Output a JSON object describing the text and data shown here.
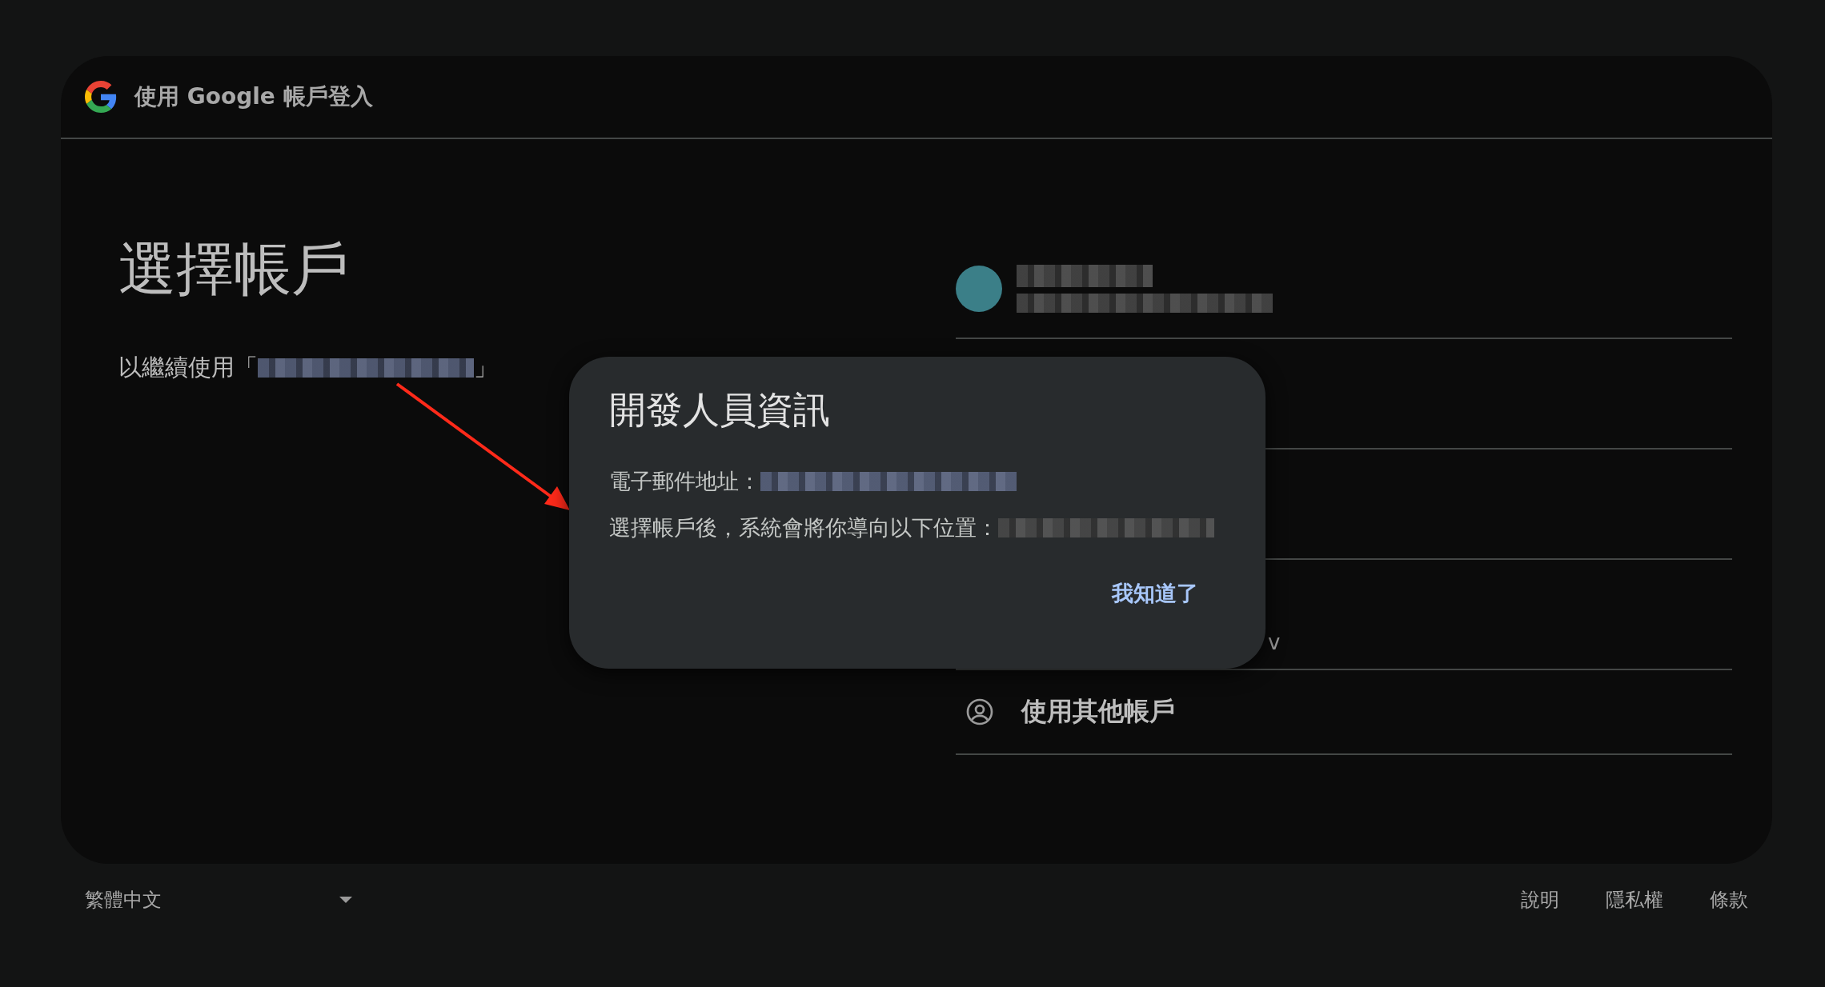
{
  "header": {
    "title": "使用 Google 帳戶登入"
  },
  "heading": "選擇帳戶",
  "subtitle_prefix": "以繼續使用「",
  "subtitle_suffix": "」",
  "account_rows": [
    {
      "kind": "account"
    },
    {
      "kind": "covered"
    },
    {
      "kind": "covered"
    },
    {
      "kind": "covered",
      "fragment": "v"
    },
    {
      "kind": "add",
      "label": "使用其他帳戶"
    }
  ],
  "dialog": {
    "title": "開發人員資訊",
    "lines": [
      {
        "label": "電子郵件地址："
      },
      {
        "label": "選擇帳戶後，系統會將你導向以下位置："
      }
    ],
    "button": "我知道了"
  },
  "footer": {
    "language": "繁體中文",
    "links": [
      "說明",
      "隱私權",
      "條款"
    ]
  }
}
